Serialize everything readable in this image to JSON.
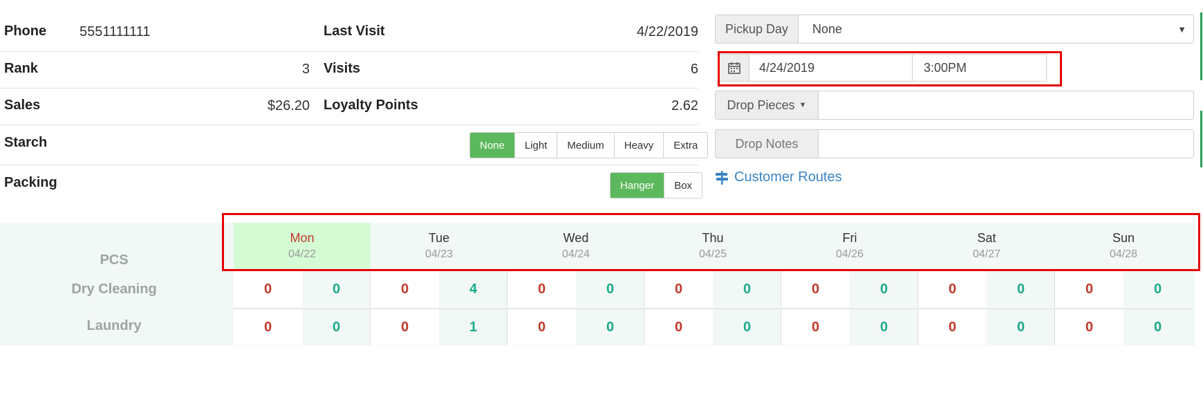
{
  "customer": {
    "phone_label": "Phone",
    "phone_value": "5551111111",
    "last_visit_label": "Last Visit",
    "last_visit_value": "4/22/2019",
    "rank_label": "Rank",
    "rank_value": "3",
    "visits_label": "Visits",
    "visits_value": "6",
    "sales_label": "Sales",
    "sales_value": "$26.20",
    "loyalty_label": "Loyalty Points",
    "loyalty_value": "2.62"
  },
  "starch": {
    "label": "Starch",
    "options": [
      "None",
      "Light",
      "Medium",
      "Heavy",
      "Extra"
    ],
    "selected": "None"
  },
  "packing": {
    "label": "Packing",
    "options": [
      "Hanger",
      "Box"
    ],
    "selected": "Hanger"
  },
  "pickup": {
    "label": "Pickup Day",
    "selected": "None",
    "date": "4/24/2019",
    "time": "3:00PM"
  },
  "drop_pieces": {
    "label": "Drop Pieces",
    "value": ""
  },
  "drop_notes": {
    "label": "Drop Notes",
    "value": ""
  },
  "routes_link": "Customer Routes",
  "colors": {
    "accent_green": "#5cb85c",
    "highlight_red": "#e60000",
    "link_blue": "#3a84c4"
  },
  "schedule": {
    "row_header": "PCS",
    "days": [
      {
        "name": "Mon",
        "date": "04/22",
        "today": true
      },
      {
        "name": "Tue",
        "date": "04/23",
        "today": false
      },
      {
        "name": "Wed",
        "date": "04/24",
        "today": false
      },
      {
        "name": "Thu",
        "date": "04/25",
        "today": false
      },
      {
        "name": "Fri",
        "date": "04/26",
        "today": false
      },
      {
        "name": "Sat",
        "date": "04/27",
        "today": false
      },
      {
        "name": "Sun",
        "date": "04/28",
        "today": false
      }
    ],
    "rows": [
      {
        "label": "Dry Cleaning",
        "cells": [
          [
            "0",
            "0"
          ],
          [
            "0",
            "4"
          ],
          [
            "0",
            "0"
          ],
          [
            "0",
            "0"
          ],
          [
            "0",
            "0"
          ],
          [
            "0",
            "0"
          ],
          [
            "0",
            "0"
          ]
        ]
      },
      {
        "label": "Laundry",
        "cells": [
          [
            "0",
            "0"
          ],
          [
            "0",
            "1"
          ],
          [
            "0",
            "0"
          ],
          [
            "0",
            "0"
          ],
          [
            "0",
            "0"
          ],
          [
            "0",
            "0"
          ],
          [
            "0",
            "0"
          ]
        ]
      }
    ]
  }
}
